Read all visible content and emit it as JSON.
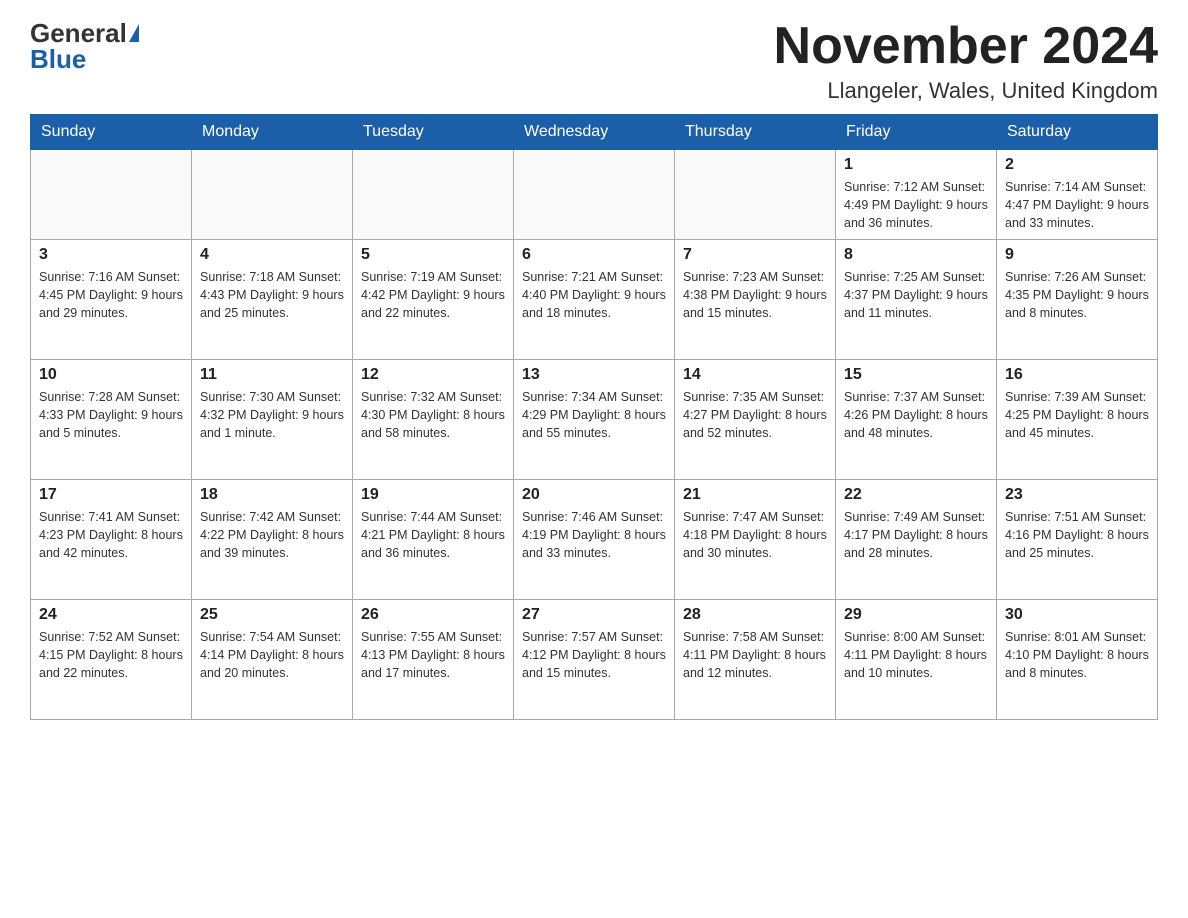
{
  "header": {
    "logo_general": "General",
    "logo_blue": "Blue",
    "month_title": "November 2024",
    "location": "Llangeler, Wales, United Kingdom"
  },
  "days_of_week": [
    "Sunday",
    "Monday",
    "Tuesday",
    "Wednesday",
    "Thursday",
    "Friday",
    "Saturday"
  ],
  "weeks": [
    {
      "days": [
        {
          "number": "",
          "info": ""
        },
        {
          "number": "",
          "info": ""
        },
        {
          "number": "",
          "info": ""
        },
        {
          "number": "",
          "info": ""
        },
        {
          "number": "",
          "info": ""
        },
        {
          "number": "1",
          "info": "Sunrise: 7:12 AM\nSunset: 4:49 PM\nDaylight: 9 hours and 36 minutes."
        },
        {
          "number": "2",
          "info": "Sunrise: 7:14 AM\nSunset: 4:47 PM\nDaylight: 9 hours and 33 minutes."
        }
      ]
    },
    {
      "days": [
        {
          "number": "3",
          "info": "Sunrise: 7:16 AM\nSunset: 4:45 PM\nDaylight: 9 hours and 29 minutes."
        },
        {
          "number": "4",
          "info": "Sunrise: 7:18 AM\nSunset: 4:43 PM\nDaylight: 9 hours and 25 minutes."
        },
        {
          "number": "5",
          "info": "Sunrise: 7:19 AM\nSunset: 4:42 PM\nDaylight: 9 hours and 22 minutes."
        },
        {
          "number": "6",
          "info": "Sunrise: 7:21 AM\nSunset: 4:40 PM\nDaylight: 9 hours and 18 minutes."
        },
        {
          "number": "7",
          "info": "Sunrise: 7:23 AM\nSunset: 4:38 PM\nDaylight: 9 hours and 15 minutes."
        },
        {
          "number": "8",
          "info": "Sunrise: 7:25 AM\nSunset: 4:37 PM\nDaylight: 9 hours and 11 minutes."
        },
        {
          "number": "9",
          "info": "Sunrise: 7:26 AM\nSunset: 4:35 PM\nDaylight: 9 hours and 8 minutes."
        }
      ]
    },
    {
      "days": [
        {
          "number": "10",
          "info": "Sunrise: 7:28 AM\nSunset: 4:33 PM\nDaylight: 9 hours and 5 minutes."
        },
        {
          "number": "11",
          "info": "Sunrise: 7:30 AM\nSunset: 4:32 PM\nDaylight: 9 hours and 1 minute."
        },
        {
          "number": "12",
          "info": "Sunrise: 7:32 AM\nSunset: 4:30 PM\nDaylight: 8 hours and 58 minutes."
        },
        {
          "number": "13",
          "info": "Sunrise: 7:34 AM\nSunset: 4:29 PM\nDaylight: 8 hours and 55 minutes."
        },
        {
          "number": "14",
          "info": "Sunrise: 7:35 AM\nSunset: 4:27 PM\nDaylight: 8 hours and 52 minutes."
        },
        {
          "number": "15",
          "info": "Sunrise: 7:37 AM\nSunset: 4:26 PM\nDaylight: 8 hours and 48 minutes."
        },
        {
          "number": "16",
          "info": "Sunrise: 7:39 AM\nSunset: 4:25 PM\nDaylight: 8 hours and 45 minutes."
        }
      ]
    },
    {
      "days": [
        {
          "number": "17",
          "info": "Sunrise: 7:41 AM\nSunset: 4:23 PM\nDaylight: 8 hours and 42 minutes."
        },
        {
          "number": "18",
          "info": "Sunrise: 7:42 AM\nSunset: 4:22 PM\nDaylight: 8 hours and 39 minutes."
        },
        {
          "number": "19",
          "info": "Sunrise: 7:44 AM\nSunset: 4:21 PM\nDaylight: 8 hours and 36 minutes."
        },
        {
          "number": "20",
          "info": "Sunrise: 7:46 AM\nSunset: 4:19 PM\nDaylight: 8 hours and 33 minutes."
        },
        {
          "number": "21",
          "info": "Sunrise: 7:47 AM\nSunset: 4:18 PM\nDaylight: 8 hours and 30 minutes."
        },
        {
          "number": "22",
          "info": "Sunrise: 7:49 AM\nSunset: 4:17 PM\nDaylight: 8 hours and 28 minutes."
        },
        {
          "number": "23",
          "info": "Sunrise: 7:51 AM\nSunset: 4:16 PM\nDaylight: 8 hours and 25 minutes."
        }
      ]
    },
    {
      "days": [
        {
          "number": "24",
          "info": "Sunrise: 7:52 AM\nSunset: 4:15 PM\nDaylight: 8 hours and 22 minutes."
        },
        {
          "number": "25",
          "info": "Sunrise: 7:54 AM\nSunset: 4:14 PM\nDaylight: 8 hours and 20 minutes."
        },
        {
          "number": "26",
          "info": "Sunrise: 7:55 AM\nSunset: 4:13 PM\nDaylight: 8 hours and 17 minutes."
        },
        {
          "number": "27",
          "info": "Sunrise: 7:57 AM\nSunset: 4:12 PM\nDaylight: 8 hours and 15 minutes."
        },
        {
          "number": "28",
          "info": "Sunrise: 7:58 AM\nSunset: 4:11 PM\nDaylight: 8 hours and 12 minutes."
        },
        {
          "number": "29",
          "info": "Sunrise: 8:00 AM\nSunset: 4:11 PM\nDaylight: 8 hours and 10 minutes."
        },
        {
          "number": "30",
          "info": "Sunrise: 8:01 AM\nSunset: 4:10 PM\nDaylight: 8 hours and 8 minutes."
        }
      ]
    }
  ]
}
